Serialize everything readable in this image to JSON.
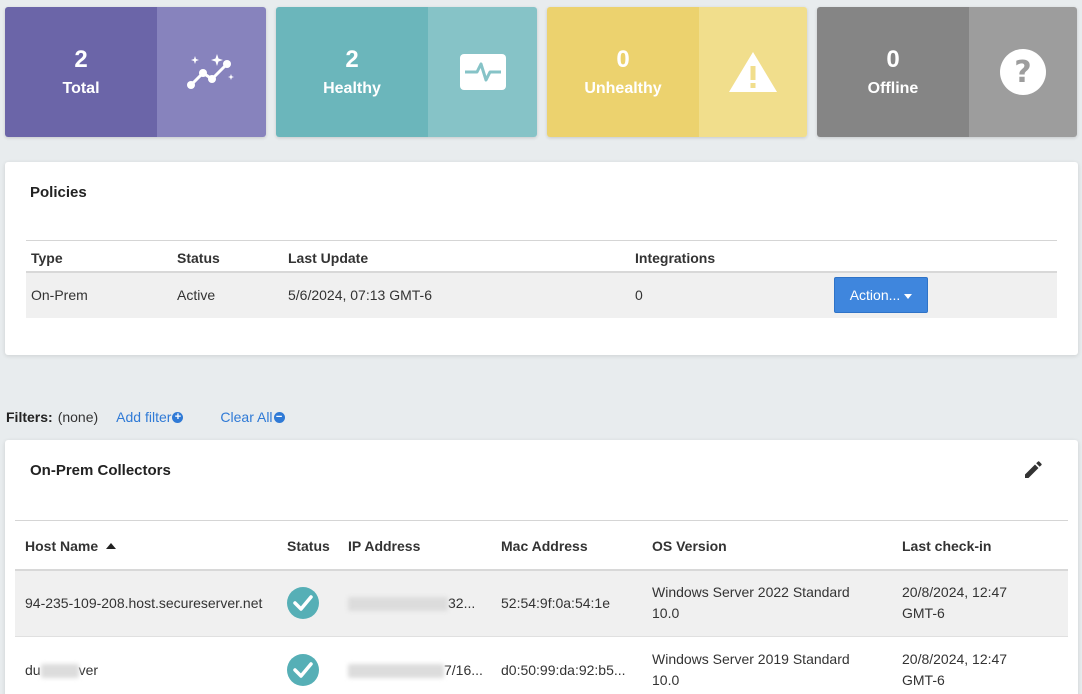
{
  "stats": [
    {
      "count": "2",
      "label": "Total",
      "icon": "trend-sparkle-icon",
      "color_dark": "#6b65a8",
      "color_light": "#8783bd"
    },
    {
      "count": "2",
      "label": "Healthy",
      "icon": "heartbeat-monitor-icon",
      "color_dark": "#6bb6bb",
      "color_light": "#86c3c7"
    },
    {
      "count": "0",
      "label": "Unhealthy",
      "icon": "warning-triangle-icon",
      "color_dark": "#ecd26e",
      "color_light": "#f1de8c"
    },
    {
      "count": "0",
      "label": "Offline",
      "icon": "question-circle-icon",
      "color_dark": "#858585",
      "color_light": "#9d9d9d"
    }
  ],
  "policies": {
    "title": "Policies",
    "columns": [
      "Type",
      "Status",
      "Last Update",
      "Integrations"
    ],
    "rows": [
      {
        "type": "On-Prem",
        "status": "Active",
        "last_update": "5/6/2024, 07:13 GMT-6",
        "integrations": "0",
        "action_label": "Action..."
      }
    ]
  },
  "filters": {
    "label": "Filters:",
    "value": "(none)",
    "add_label": "Add filter",
    "clear_label": "Clear All"
  },
  "collectors": {
    "title": "On-Prem Collectors",
    "edit_icon": "pencil-icon",
    "columns": [
      "Host Name",
      "Status",
      "IP Address",
      "Mac Address",
      "OS Version",
      "Last check-in"
    ],
    "rows": [
      {
        "host": "94-235-109-208.host.secureserver.net",
        "host_prefix": "",
        "host_suffix": "",
        "status_icon": "check-circle-icon",
        "ip_suffix": "32...",
        "mac": "52:54:9f:0a:54:1e",
        "os_line1": "Windows Server 2022 Standard",
        "os_line2": "10.0",
        "checkin_line1": "20/8/2024, 12:47",
        "checkin_line2": "GMT-6"
      },
      {
        "host": "",
        "host_prefix": "du",
        "host_suffix": "ver",
        "status_icon": "check-circle-icon",
        "ip_suffix": "7/16...",
        "mac": "d0:50:99:da:92:b5...",
        "os_line1": "Windows Server 2019 Standard",
        "os_line2": "10.0",
        "checkin_line1": "20/8/2024, 12:47",
        "checkin_line2": "GMT-6"
      }
    ]
  },
  "colors": {
    "accent": "#3f86dd",
    "link": "#2f7ad6",
    "status_ok": "#56afb6"
  }
}
